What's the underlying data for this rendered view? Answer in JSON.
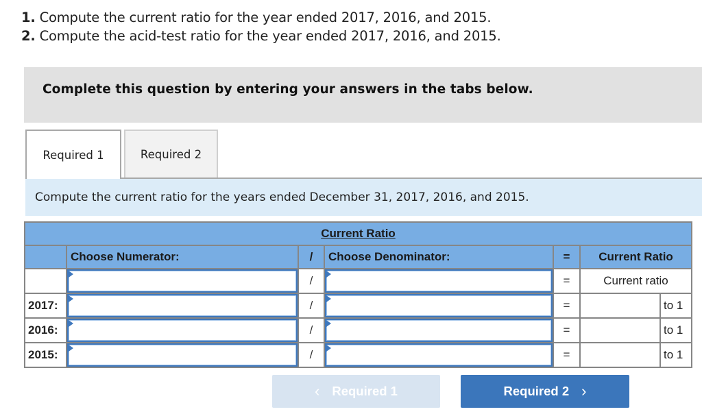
{
  "questions": [
    {
      "number": "1.",
      "text": " Compute the current ratio for the year ended 2017, 2016, and 2015."
    },
    {
      "number": "2.",
      "text": " Compute the acid-test ratio for the year ended 2017, 2016, and 2015."
    }
  ],
  "instruction": "Complete this question by entering your answers in the tabs below.",
  "tabs": [
    {
      "label": "Required 1",
      "active": true
    },
    {
      "label": "Required 2",
      "active": false
    }
  ],
  "prompt": "Compute the current ratio for the years ended December 31, 2017, 2016, and 2015.",
  "table": {
    "title": "Current Ratio",
    "headers": {
      "numerator": "Choose Numerator:",
      "slash": "/",
      "denominator": "Choose Denominator:",
      "equals": "=",
      "result": "Current Ratio"
    },
    "formula_row": {
      "year": "",
      "numerator": "",
      "slash": "/",
      "denominator": "",
      "equals": "=",
      "result": "Current ratio"
    },
    "rows": [
      {
        "year": "2017:",
        "numerator": "",
        "slash": "/",
        "denominator": "",
        "equals": "=",
        "result": "",
        "suffix": "to 1"
      },
      {
        "year": "2016:",
        "numerator": "",
        "slash": "/",
        "denominator": "",
        "equals": "=",
        "result": "",
        "suffix": "to 1"
      },
      {
        "year": "2015:",
        "numerator": "",
        "slash": "/",
        "denominator": "",
        "equals": "=",
        "result": "",
        "suffix": "to 1"
      }
    ]
  },
  "navigation": {
    "prev_label": "Required 1",
    "prev_icon": "chevron-left-icon",
    "prev_chevron": "‹",
    "next_label": "Required 2",
    "next_icon": "chevron-right-icon",
    "next_chevron": "›"
  },
  "colors": {
    "table_header": "#78ade3",
    "prompt_bg": "#dcecf8",
    "instruction_bg": "#e1e1e1",
    "next_button": "#3b76bb",
    "prev_button_disabled": "#d8e4f1"
  }
}
